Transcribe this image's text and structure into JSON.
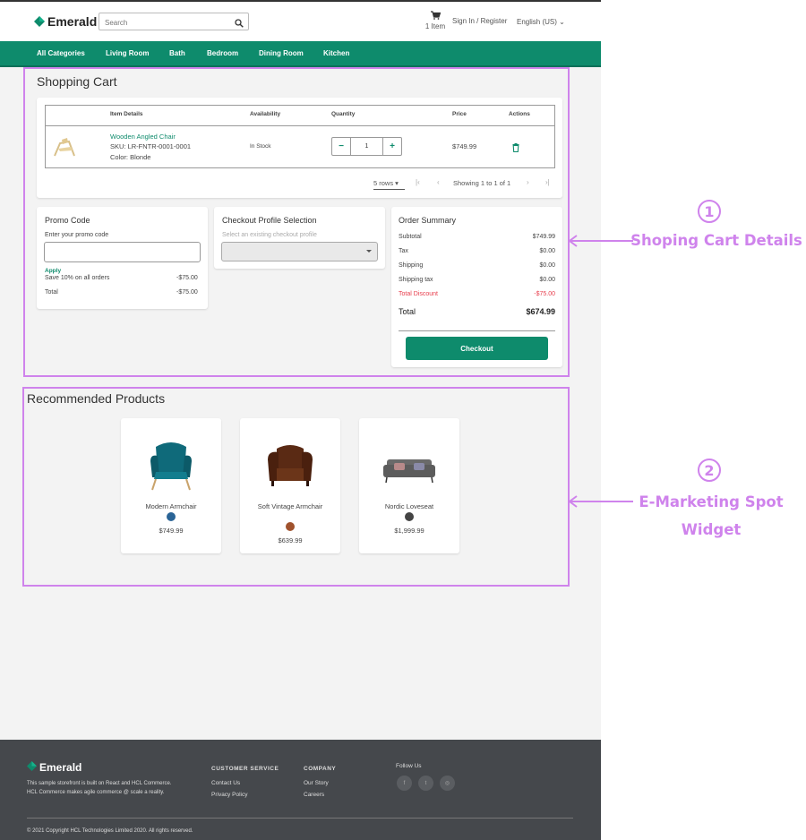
{
  "header": {
    "brand": "Emerald",
    "search_placeholder": "Search",
    "cart_count": "1 Item",
    "sign_in": "Sign In / Register",
    "language": "English (US)"
  },
  "nav": {
    "items": [
      "All Categories",
      "Living Room",
      "Bath",
      "Bedroom",
      "Dining Room",
      "Kitchen"
    ]
  },
  "cart": {
    "title": "Shopping Cart",
    "columns": [
      "Item Details",
      "Availability",
      "Quantity",
      "Price",
      "Actions"
    ],
    "item": {
      "name": "Wooden Angled Chair",
      "sku": "SKU: LR-FNTR-0001-0001",
      "color": "Color: Blonde",
      "availability": "In Stock",
      "quantity": "1",
      "price": "$749.99"
    },
    "pager": {
      "rows": "5 rows",
      "showing": "Showing 1 to 1 of 1"
    }
  },
  "promo": {
    "title": "Promo Code",
    "label": "Enter your promo code",
    "apply": "Apply",
    "discount_label": "Save 10% on all orders",
    "discount_value": "-$75.00",
    "total_label": "Total",
    "total_value": "-$75.00"
  },
  "checkout_profile": {
    "title": "Checkout Profile Selection",
    "placeholder": "Select an existing checkout profile"
  },
  "order_summary": {
    "title": "Order Summary",
    "rows": [
      {
        "label": "Subtotal",
        "value": "$749.99"
      },
      {
        "label": "Tax",
        "value": "$0.00"
      },
      {
        "label": "Shipping",
        "value": "$0.00"
      },
      {
        "label": "Shipping tax",
        "value": "$0.00"
      },
      {
        "label": "Total Discount",
        "value": "-$75.00"
      }
    ],
    "total_label": "Total",
    "total_value": "$674.99",
    "checkout": "Checkout",
    "discount_color": "#e8404f"
  },
  "recommended": {
    "title": "Recommended Products",
    "products": [
      {
        "name": "Modern Armchair",
        "price": "$749.99",
        "swatch": "#2a6496"
      },
      {
        "name": "Soft Vintage Armchair",
        "price": "$639.99",
        "swatch": "#a0522d"
      },
      {
        "name": "Nordic Loveseat",
        "price": "$1,999.99",
        "swatch": "#444444"
      }
    ]
  },
  "footer": {
    "brand": "Emerald",
    "tagline_1": "This sample storefront is built on React and HCL Commerce.",
    "tagline_2": "HCL Commerce makes agile commerce @ scale a reality.",
    "customer_service": "CUSTOMER SERVICE",
    "contact": "Contact Us",
    "privacy": "Privacy Policy",
    "company": "COMPANY",
    "story": "Our Story",
    "careers": "Careers",
    "follow": "Follow Us",
    "copyright": "© 2021 Copyright HCL Technologies Limited 2020. All rights reserved."
  },
  "annotations": {
    "one_num": "1",
    "one_text": "Shoping Cart Details",
    "two_num": "2",
    "two_text_1": "E-Marketing Spot",
    "two_text_2": "Widget",
    "color": "#cf83ec"
  },
  "colors": {
    "brand_green": "#0e8b6c",
    "footer_bg": "#45484c"
  }
}
